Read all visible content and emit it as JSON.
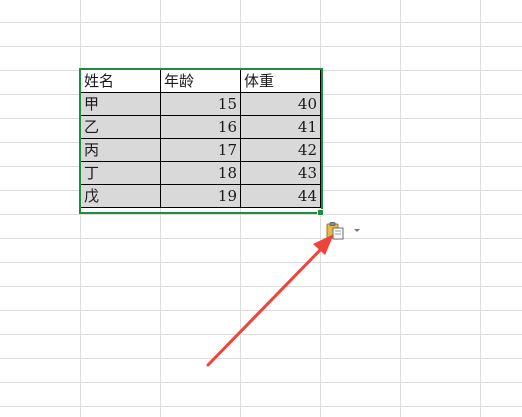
{
  "table": {
    "headers": [
      "姓名",
      "年龄",
      "体重"
    ],
    "rows": [
      {
        "name": "甲",
        "age": "15",
        "weight": "40"
      },
      {
        "name": "乙",
        "age": "16",
        "weight": "41"
      },
      {
        "name": "丙",
        "age": "17",
        "weight": "42"
      },
      {
        "name": "丁",
        "age": "18",
        "weight": "43"
      },
      {
        "name": "戊",
        "age": "19",
        "weight": "44"
      }
    ]
  },
  "paste_options": {
    "icon": "clipboard-paste-icon",
    "caret_icon": "chevron-down-icon"
  },
  "annotation": {
    "arrow_color": "#f0443a"
  },
  "colors": {
    "selection_border": "#1e8e3e",
    "filled_cell": "#d9d9d9",
    "gridline": "#dcdcdc"
  }
}
